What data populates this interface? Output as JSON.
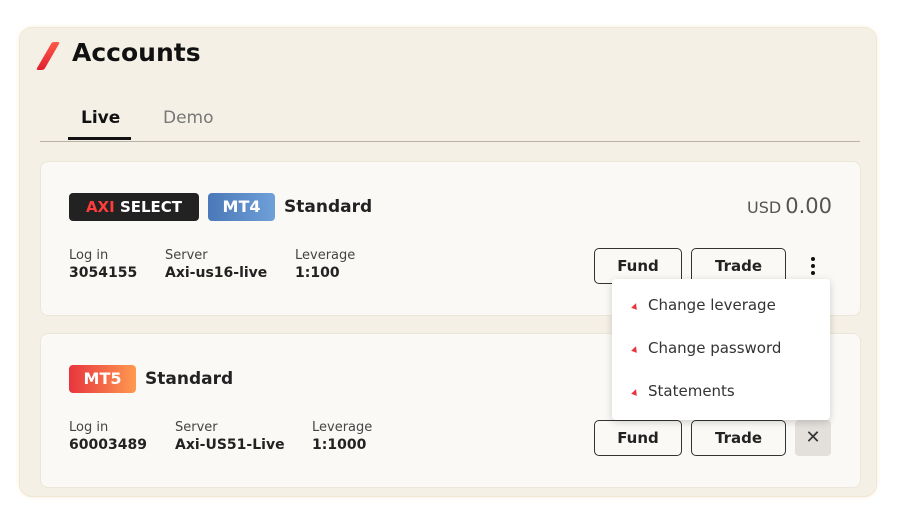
{
  "header": {
    "title": "Accounts"
  },
  "tabs": [
    {
      "label": "Live",
      "active": true
    },
    {
      "label": "Demo",
      "active": false
    }
  ],
  "accounts": [
    {
      "badges": {
        "program_prefix": "AXI",
        "program_suffix": " SELECT",
        "platform": "MT4"
      },
      "type": "Standard",
      "balance": {
        "currency": "USD",
        "amount": "0.00"
      },
      "login_label": "Log in",
      "login": "3054155",
      "server_label": "Server",
      "server": "Axi-us16-live",
      "leverage_label": "Leverage",
      "leverage": "1:100",
      "fund_label": "Fund",
      "trade_label": "Trade"
    },
    {
      "badges": {
        "platform": "MT5"
      },
      "type": "Standard",
      "login_label": "Log in",
      "login": "60003489",
      "server_label": "Server",
      "server": "Axi-US51-Live",
      "leverage_label": "Leverage",
      "leverage": "1:1000",
      "fund_label": "Fund",
      "trade_label": "Trade",
      "close_glyph": "✕"
    }
  ],
  "menu": {
    "items": [
      "Change leverage",
      "Change password",
      "Statements"
    ]
  },
  "colors": {
    "accent": "#e8343e",
    "mt4": "#4a78b8",
    "panel": "#f5f0e6"
  }
}
